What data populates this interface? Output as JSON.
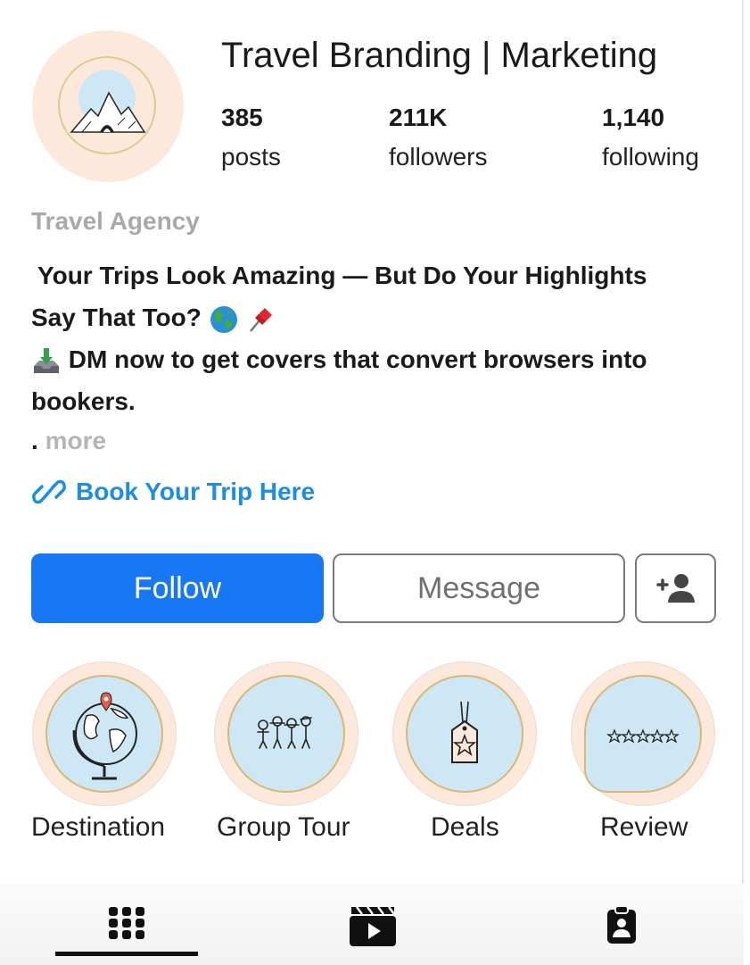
{
  "profile": {
    "username": "Travel Branding | Marketing",
    "category": "Travel Agency",
    "stats": [
      {
        "value": "385",
        "label": "posts"
      },
      {
        "value": "211K",
        "label": "followers"
      },
      {
        "value": "1,140",
        "label": "following"
      }
    ],
    "bio": {
      "line1": "Your Trips Look Amazing — But Do Your Highlights",
      "line2": "Say That Too?",
      "line3": "DM now to get covers that convert browsers into",
      "line4": "bookers.",
      "dot": ".",
      "more": "more"
    },
    "link_text": "Book Your Trip Here"
  },
  "actions": {
    "follow": "Follow",
    "message": "Message"
  },
  "highlights": [
    {
      "label": "Destination",
      "icon": "globe-icon"
    },
    {
      "label": "Group Tour",
      "icon": "people-icon"
    },
    {
      "label": "Deals",
      "icon": "tag-icon"
    },
    {
      "label": "Review",
      "icon": "stars-bubble-icon"
    }
  ],
  "tabs": [
    {
      "icon": "grid-icon",
      "active": true
    },
    {
      "icon": "reels-icon",
      "active": false
    },
    {
      "icon": "tagged-icon",
      "active": false
    }
  ],
  "colors": {
    "follow": "#1877f2",
    "link": "#1d8ce3",
    "avatar_bg": "#fde9dc",
    "highlight_inner": "#cde8f4"
  }
}
